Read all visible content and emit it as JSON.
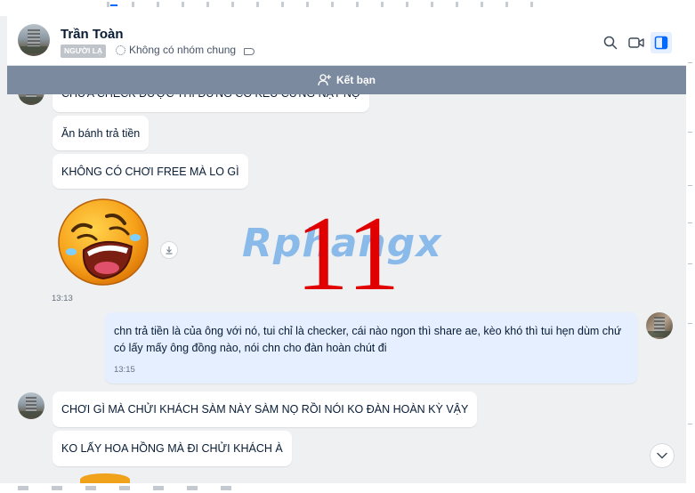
{
  "header": {
    "contact_name": "Trần Toàn",
    "stranger_badge": "NGƯỜI LẠ",
    "group_info": "Không có nhóm chung"
  },
  "icons": {
    "search": "search-icon",
    "video_call": "video-call-icon",
    "side_panel": "side-panel-icon",
    "add_friend": "add-user-icon",
    "download": "download-icon",
    "scroll_down": "chevron-down-icon",
    "label": "label-tag-icon",
    "group": "spinner-icon"
  },
  "friend_bar": {
    "label": "Kết bạn"
  },
  "messages": [
    {
      "sender": "them",
      "text": "CHƯA CHECK ĐƯỢC THÌ ĐỪNG CÓ KÊU CỨNG NẠT NỘ"
    },
    {
      "sender": "them",
      "text": "Ăn bánh trả tiền"
    },
    {
      "sender": "them",
      "text": "KHÔNG CÓ CHƠI FREE MÀ LO GÌ"
    },
    {
      "sender": "them",
      "type": "sticker",
      "time": "13:13"
    },
    {
      "sender": "me",
      "text": "chn trả tiền là của ông với nó, tui chỉ là checker, cái nào ngon thì share ae, kèo khó thì tui hẹn dùm chứ có lấy mấy ông đồng nào, nói chn cho đàn hoàn chút đi",
      "time": "13:15"
    },
    {
      "sender": "them",
      "text": "CHƠI GÌ MÀ CHỬI KHÁCH SÀM NÀY SÀM NỌ RỒI NÓI KO ĐÀN HOÀN KỲ VẬY"
    },
    {
      "sender": "them",
      "text": "KO LẤY HOA HỒNG MÀ ĐI CHỬI KHÁCH À"
    }
  ],
  "overlay": {
    "watermark": "Rphangx",
    "number": "11"
  },
  "colors": {
    "friend_bar_bg": "#7c8aa0",
    "own_bubble_bg": "#e5efff",
    "accent": "#0068ff",
    "overlay_number": "#e00000"
  }
}
